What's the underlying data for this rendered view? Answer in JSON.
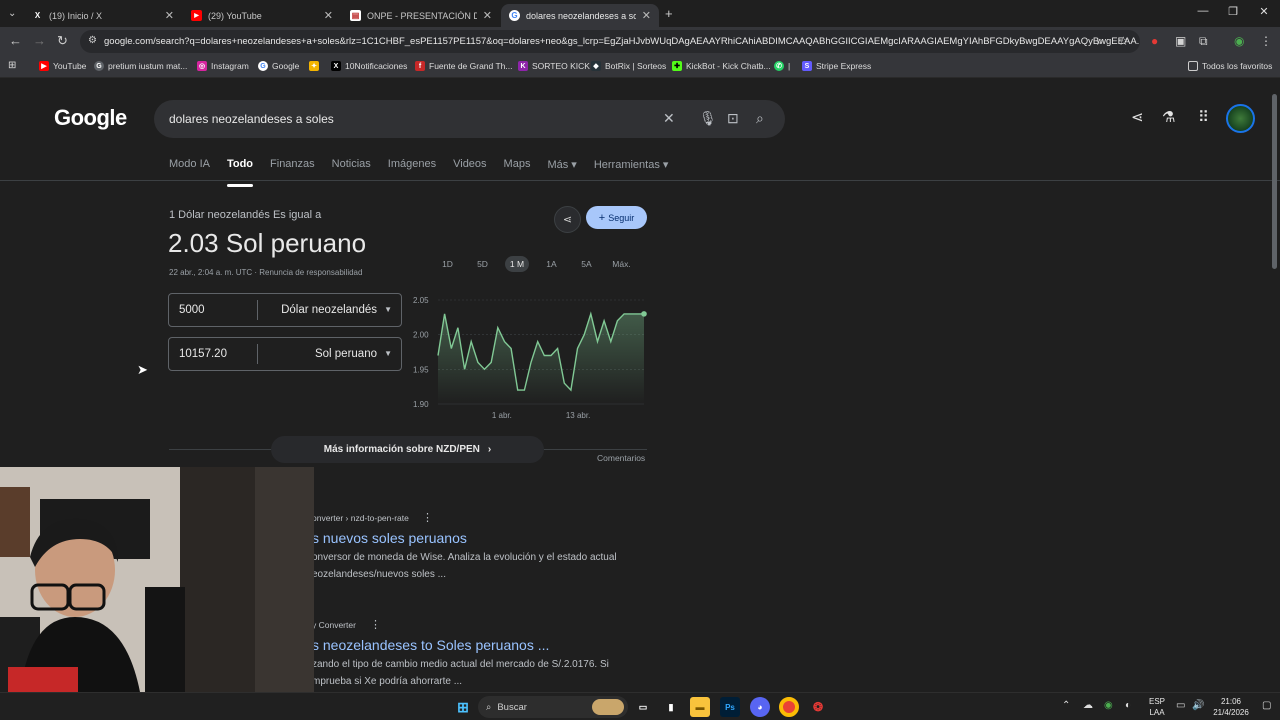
{
  "browser": {
    "tabs": [
      {
        "title": "(19) Inicio / X",
        "icon": "x-logo-icon"
      },
      {
        "title": "(29) YouTube",
        "icon": "youtube-icon"
      },
      {
        "title": "ONPE - PRESENTACIÓN DE RE",
        "icon": "onpe-icon"
      },
      {
        "title": "dolares neozelandeses a soles",
        "icon": "google-icon"
      }
    ],
    "new_tab": "+",
    "url": "google.com/search?q=dolares+neozelandeses+a+soles&rlz=1C1CHBF_esPE1157PE1157&oq=dolares+neo&gs_lcrp=EgZjaHJvbWUqDAgAEAAYRhiCAhiABDIMCAAQABhGGIICGIAEMgcIARAAGIAEMgYIAhBFGDkyBwgDEAAYgAQyBwgEEAA...",
    "bookmarks": [
      {
        "label": "YouTube",
        "color": "#ff0000"
      },
      {
        "label": "pretium iustum mat...",
        "color": "#5f6368"
      },
      {
        "label": "Instagram",
        "color": "#d6249f"
      },
      {
        "label": "Google",
        "color": "#4285f4"
      },
      {
        "label": "",
        "color": "#f4b400"
      },
      {
        "label": "10Notificaciones",
        "color": "#000000"
      },
      {
        "label": "Fuente de Grand Th...",
        "color": "#c62828"
      },
      {
        "label": "SORTEO KICK",
        "color": "#8e24aa"
      },
      {
        "label": "BotRix | Sorteos",
        "color": "#263238"
      },
      {
        "label": "KickBot - Kick Chatb...",
        "color": "#53fc18"
      },
      {
        "label": "|",
        "color": "#25d366"
      },
      {
        "label": "Stripe Express",
        "color": "#635bff"
      }
    ],
    "all_bookmarks": "Todos los favoritos"
  },
  "google": {
    "logo": "Google",
    "query": "dolares neozelandeses a soles",
    "nav_tabs": [
      "Modo IA",
      "Todo",
      "Finanzas",
      "Noticias",
      "Imágenes",
      "Videos",
      "Maps",
      "Más ▾",
      "Herramientas ▾"
    ],
    "active_tab": "Todo"
  },
  "converter": {
    "subtitle": "1 Dólar neozelandés Es igual a",
    "main": "2.03 Sol peruano",
    "date": "22 abr., 2:04 a. m. UTC · Renuncia de responsabilidad",
    "follow": "Seguir",
    "from_value": "5000",
    "from_currency": "Dólar neozelandés",
    "to_value": "10157.20",
    "to_currency": "Sol peruano",
    "ranges": [
      "1D",
      "5D",
      "1 M",
      "1A",
      "5A",
      "Máx."
    ],
    "active_range": "1 M",
    "more_info": "Más información sobre NZD/PEN",
    "comments": "Comentarios"
  },
  "chart_data": {
    "type": "area",
    "title": "",
    "xlabel": "",
    "ylabel": "",
    "ylim": [
      1.9,
      2.05
    ],
    "yticks": [
      "2.05",
      "2.00",
      "1.95",
      "1.90"
    ],
    "xticks": [
      "1 abr.",
      "13 abr."
    ],
    "color": "#81c995",
    "values": [
      1.97,
      2.03,
      1.98,
      2.01,
      1.95,
      1.99,
      1.96,
      1.95,
      1.96,
      2.01,
      1.99,
      1.98,
      1.92,
      1.92,
      1.96,
      1.99,
      1.97,
      1.97,
      1.98,
      1.93,
      1.92,
      1.98,
      2.0,
      2.03,
      1.99,
      2.02,
      1.99,
      2.02,
      2.03,
      2.03,
      2.03,
      2.03
    ]
  },
  "results": [
    {
      "cite": "onverter › nzd-to-pen-rate",
      "title": "s nuevos soles peruanos",
      "snippet1": "onversor de moneda de Wise. Analiza la evolución y el estado actual",
      "snippet2": "eozelandeses/nuevos soles ..."
    },
    {
      "cite": "y Converter",
      "title": "s neozelandeses to Soles peruanos ...",
      "snippet1": "zando el tipo de cambio medio actual del mercado de S/.2.0176. Si",
      "snippet2": "mprueba si Xe podría ahorrarte ..."
    }
  ],
  "taskbar": {
    "search": "Buscar",
    "lang1": "ESP",
    "lang2": "LAA",
    "time": "21:06",
    "date": "21/4/2026"
  }
}
